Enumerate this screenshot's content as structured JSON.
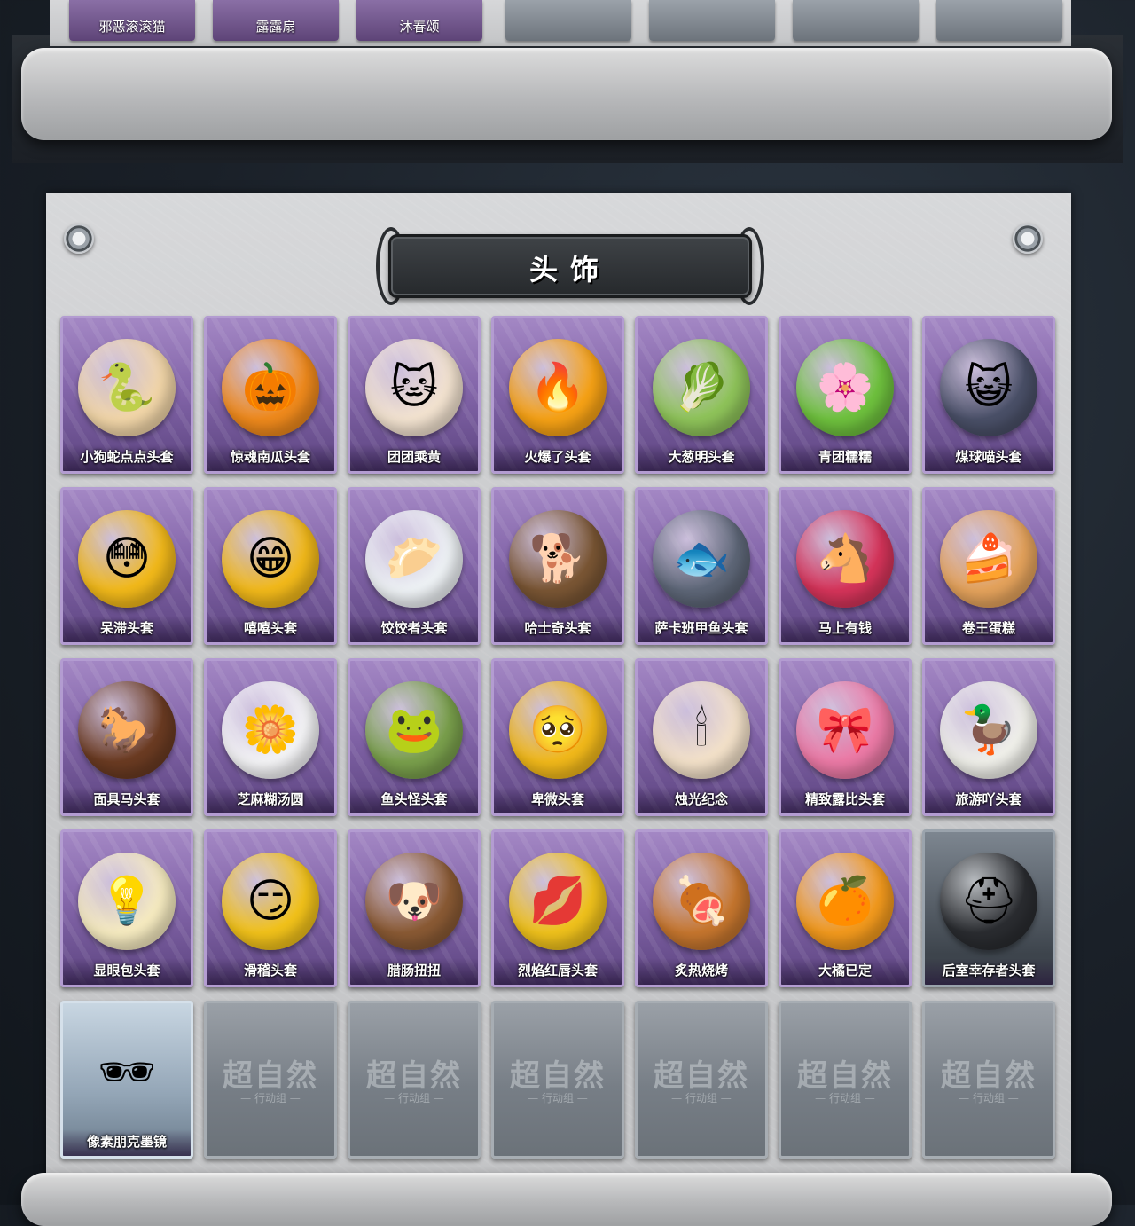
{
  "top_section": {
    "cards": [
      {
        "name": "邪恶滚滚猫",
        "state": "filled"
      },
      {
        "name": "露露扇",
        "state": "filled"
      },
      {
        "name": "沐春颂",
        "state": "filled"
      },
      {
        "name": "",
        "state": "empty"
      },
      {
        "name": "",
        "state": "empty"
      },
      {
        "name": "",
        "state": "empty"
      },
      {
        "name": "",
        "state": "empty"
      }
    ]
  },
  "section": {
    "title": "头饰"
  },
  "watermark": {
    "main": "超自然",
    "sub": "行动组"
  },
  "items": [
    {
      "name": "小狗蛇点点头套",
      "style": "purple",
      "icon": "snake-dog-head",
      "color": "#f2d6a8",
      "glyph": "🐍"
    },
    {
      "name": "惊魂南瓜头套",
      "style": "purple",
      "icon": "pumpkin-head",
      "color": "#f08a1c",
      "glyph": "🎃"
    },
    {
      "name": "团团乘黄",
      "style": "purple",
      "icon": "cream-cat-head",
      "color": "#f3e3d0",
      "glyph": "🐱"
    },
    {
      "name": "火爆了头套",
      "style": "purple",
      "icon": "fire-head",
      "color": "#f7a215",
      "glyph": "🔥"
    },
    {
      "name": "大葱明头套",
      "style": "purple",
      "icon": "scallion-head",
      "color": "#8fc45a",
      "glyph": "🥬"
    },
    {
      "name": "青团糯糯",
      "style": "purple",
      "icon": "green-dumpling-head",
      "color": "#6fc23e",
      "glyph": "🌸"
    },
    {
      "name": "煤球喵头套",
      "style": "purple",
      "icon": "black-cat-head",
      "color": "#4a5068",
      "glyph": "😺"
    },
    {
      "name": "呆滞头套",
      "style": "purple",
      "icon": "dazed-emoji-head",
      "color": "#f2b91a",
      "glyph": "😳"
    },
    {
      "name": "嘻嘻头套",
      "style": "purple",
      "icon": "grin-emoji-head",
      "color": "#f2b91a",
      "glyph": "😁"
    },
    {
      "name": "饺饺者头套",
      "style": "purple",
      "icon": "dumpling-head",
      "color": "#eef2f5",
      "glyph": "🥟"
    },
    {
      "name": "哈士奇头套",
      "style": "purple",
      "icon": "husky-head",
      "color": "#7a5634",
      "glyph": "🐕"
    },
    {
      "name": "萨卡班甲鱼头套",
      "style": "purple",
      "icon": "fish-head",
      "color": "#5e6778",
      "glyph": "🐟"
    },
    {
      "name": "马上有钱",
      "style": "purple",
      "icon": "red-horse-head",
      "color": "#d6345a",
      "glyph": "🐴"
    },
    {
      "name": "卷王蛋糕",
      "style": "purple",
      "icon": "roll-cake-head",
      "color": "#e5a35c",
      "glyph": "🍰"
    },
    {
      "name": "面具马头套",
      "style": "purple",
      "icon": "horse-mask-head",
      "color": "#6b3b22",
      "glyph": "🐎"
    },
    {
      "name": "芝麻糊汤圆",
      "style": "purple",
      "icon": "rice-ball-head",
      "color": "#f4f4f6",
      "glyph": "🌼"
    },
    {
      "name": "鱼头怪头套",
      "style": "purple",
      "icon": "fish-monster-head",
      "color": "#7aa04c",
      "glyph": "🐸"
    },
    {
      "name": "卑微头套",
      "style": "purple",
      "icon": "humble-emoji-head",
      "color": "#f2b91a",
      "glyph": "🥺"
    },
    {
      "name": "烛光纪念",
      "style": "purple",
      "icon": "candle-head",
      "color": "#f3e1c9",
      "glyph": "🕯"
    },
    {
      "name": "精致露比头套",
      "style": "purple",
      "icon": "pink-beaver-head",
      "color": "#ec7aa6",
      "glyph": "🎀"
    },
    {
      "name": "旅游吖头套",
      "style": "purple",
      "icon": "duck-hat-head",
      "color": "#f0f0ea",
      "glyph": "🦆"
    },
    {
      "name": "显眼包头套",
      "style": "purple",
      "icon": "bulb-crown-head",
      "color": "#f6ebc0",
      "glyph": "💡"
    },
    {
      "name": "滑稽头套",
      "style": "purple",
      "icon": "funny-emoji-head",
      "color": "#f2c21a",
      "glyph": "😏"
    },
    {
      "name": "腊肠扭扭",
      "style": "purple",
      "icon": "dachshund-head",
      "color": "#8a5a34",
      "glyph": "🐶"
    },
    {
      "name": "烈焰红唇头套",
      "style": "purple",
      "icon": "yellow-mouse-head",
      "color": "#f0c21c",
      "glyph": "💋"
    },
    {
      "name": "炙热烧烤",
      "style": "purple",
      "icon": "bbq-meat-head",
      "color": "#c6762e",
      "glyph": "🍖"
    },
    {
      "name": "大橘已定",
      "style": "purple",
      "icon": "orange-slice-head",
      "color": "#f39a1d",
      "glyph": "🍊"
    },
    {
      "name": "后室幸存者头套",
      "style": "dark",
      "icon": "gas-mask-helmet",
      "color": "#2a2c30",
      "glyph": "⛑"
    },
    {
      "name": "像素朋克墨镜",
      "style": "light",
      "icon": "pixel-sunglasses",
      "color": "#111111",
      "glyph": "🕶"
    },
    {
      "name": "",
      "style": "empty",
      "icon": "placeholder-logo"
    },
    {
      "name": "",
      "style": "empty",
      "icon": "placeholder-logo"
    },
    {
      "name": "",
      "style": "empty",
      "icon": "placeholder-logo"
    },
    {
      "name": "",
      "style": "empty",
      "icon": "placeholder-logo"
    },
    {
      "name": "",
      "style": "empty",
      "icon": "placeholder-logo"
    },
    {
      "name": "",
      "style": "empty",
      "icon": "placeholder-logo"
    }
  ]
}
